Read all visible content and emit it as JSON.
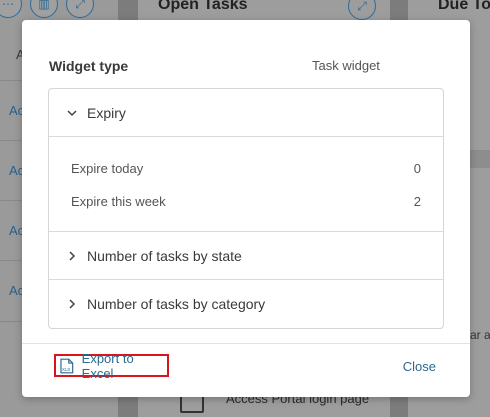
{
  "background": {
    "left_column_header": "A",
    "left_rows": [
      "Ac",
      "Ac",
      "Ac",
      "Ac"
    ],
    "middle_title": "Open Tasks",
    "right_title": "Due To",
    "bottom_item": "Access Portal login page",
    "right_clip": "ar a"
  },
  "dialog": {
    "widget_type_label": "Widget type",
    "widget_type_value": "Task widget",
    "sections": [
      {
        "label": "Expiry",
        "expanded": true
      },
      {
        "label": "Number of tasks by state",
        "expanded": false
      },
      {
        "label": "Number of tasks by category",
        "expanded": false
      }
    ],
    "expiry_rows": [
      {
        "label": "Expire today",
        "value": "0"
      },
      {
        "label": "Expire this week",
        "value": "2"
      }
    ],
    "export_label": "Export to Excel",
    "close_label": "Close"
  },
  "icons": [
    "chevron-down-icon",
    "chevron-right-icon",
    "excel-file-icon",
    "bar-chart-icon",
    "expand-icon",
    "document-share-icon"
  ],
  "colors": {
    "link": "#2a6a8e",
    "highlight": "#d9141b"
  }
}
